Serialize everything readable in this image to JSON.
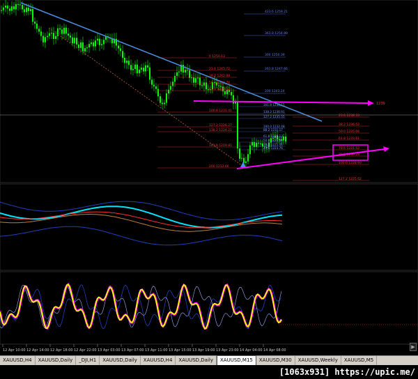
{
  "time_axis": [
    "12 Apr 10:00",
    "12 Apr 14:00",
    "12 Apr 18:00",
    "12 Apr 22:00",
    "13 Apr 03:00",
    "13 Apr 07:00",
    "13 Apr 11:00",
    "13 Apr 15:00",
    "13 Apr 19:00",
    "13 Apr 23:00",
    "14 Apr 04:00",
    "14 Apr 08:00"
  ],
  "fib_upper": [
    "423.6 1259.21",
    "361.8 1254.89",
    "300 1250.39",
    "261.8 1247.66",
    "200 1243.24"
  ],
  "fib_red": [
    "0 1250.13",
    "23.6 1245.72",
    "38.2 1242.98",
    "50.0 1240.76",
    "61.8 1238.52",
    "100.0 1231.41",
    "127.2 1226.27",
    "138.2 1224.21",
    "161.8 1219.81",
    "200 1212.66"
  ],
  "fib_blue_mid": [
    "161.8 1238.15",
    "138.2 1236.91",
    "127.2 1235.55",
    "100.0 1232.48",
    "88.2 1231.17",
    "61.8 1228.13",
    "50.0 1226.80",
    "38.2 1225.41",
    "23.6 1223.76"
  ],
  "fib_right": [
    "23.6 1238.33",
    "38.2 1236.52",
    "50.0 1235.06",
    "61.8 1233.61",
    "78.6 1231.52",
    "88.6 1230.28",
    "100.0 1228.93",
    "127.2 1225.62"
  ],
  "price_level": "1239",
  "tabs": [
    "XAUUSD,H4",
    "XAUUSD,Daily",
    "_DJI,H1",
    "XAUUSD,Daily",
    "XAUUSD,H4",
    "XAUUSD,Daily",
    "XAUUSD,M15",
    "XAUUSD,M30",
    "XAUUSD,Weekly",
    "XAUUSD,M5"
  ],
  "active_tab": "XAUUSD,M15",
  "watermark": "[1063x931] https://upic.me/",
  "colors": {
    "bull": "#00ff00",
    "trend": "#4a90e2",
    "fib_red": "#ff3030",
    "fib_blue": "#5c7fff",
    "magenta": "#ff00ff",
    "cyan": "#00e5ff",
    "yellow": "#ffff00"
  }
}
